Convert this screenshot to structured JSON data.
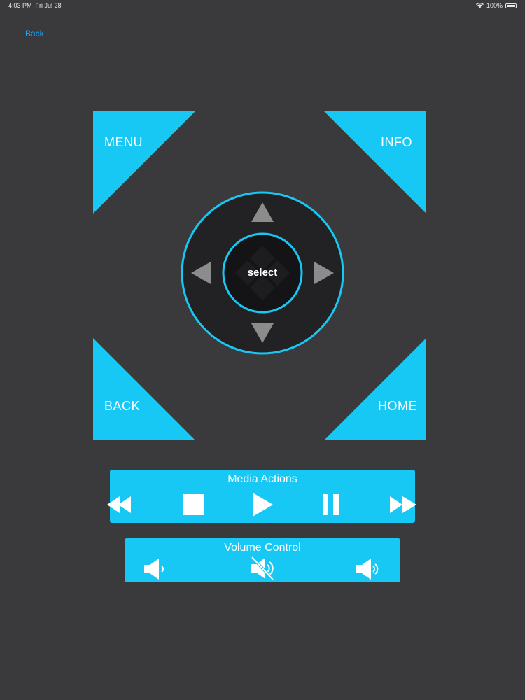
{
  "status_bar": {
    "time": "4:03 PM",
    "date": "Fri Jul 28",
    "battery": "100%"
  },
  "nav": {
    "back_label": "Back"
  },
  "corner_buttons": {
    "menu": "MENU",
    "info": "INFO",
    "back": "BACK",
    "home": "HOME"
  },
  "dpad": {
    "select_label": "select"
  },
  "media": {
    "title": "Media Actions"
  },
  "volume": {
    "title": "Volume Control"
  },
  "colors": {
    "accent": "#17c8f5",
    "background": "#3a3a3c",
    "link": "#1aa7ff",
    "dpad_dark": "#222224",
    "arrow_gray": "#8c8c8c"
  },
  "icons": [
    "wifi-icon",
    "battery-icon",
    "rewind-icon",
    "stop-icon",
    "play-icon",
    "pause-icon",
    "fast-forward-icon",
    "volume-down-icon",
    "mute-icon",
    "volume-up-icon",
    "arrow-up-icon",
    "arrow-down-icon",
    "arrow-left-icon",
    "arrow-right-icon"
  ]
}
